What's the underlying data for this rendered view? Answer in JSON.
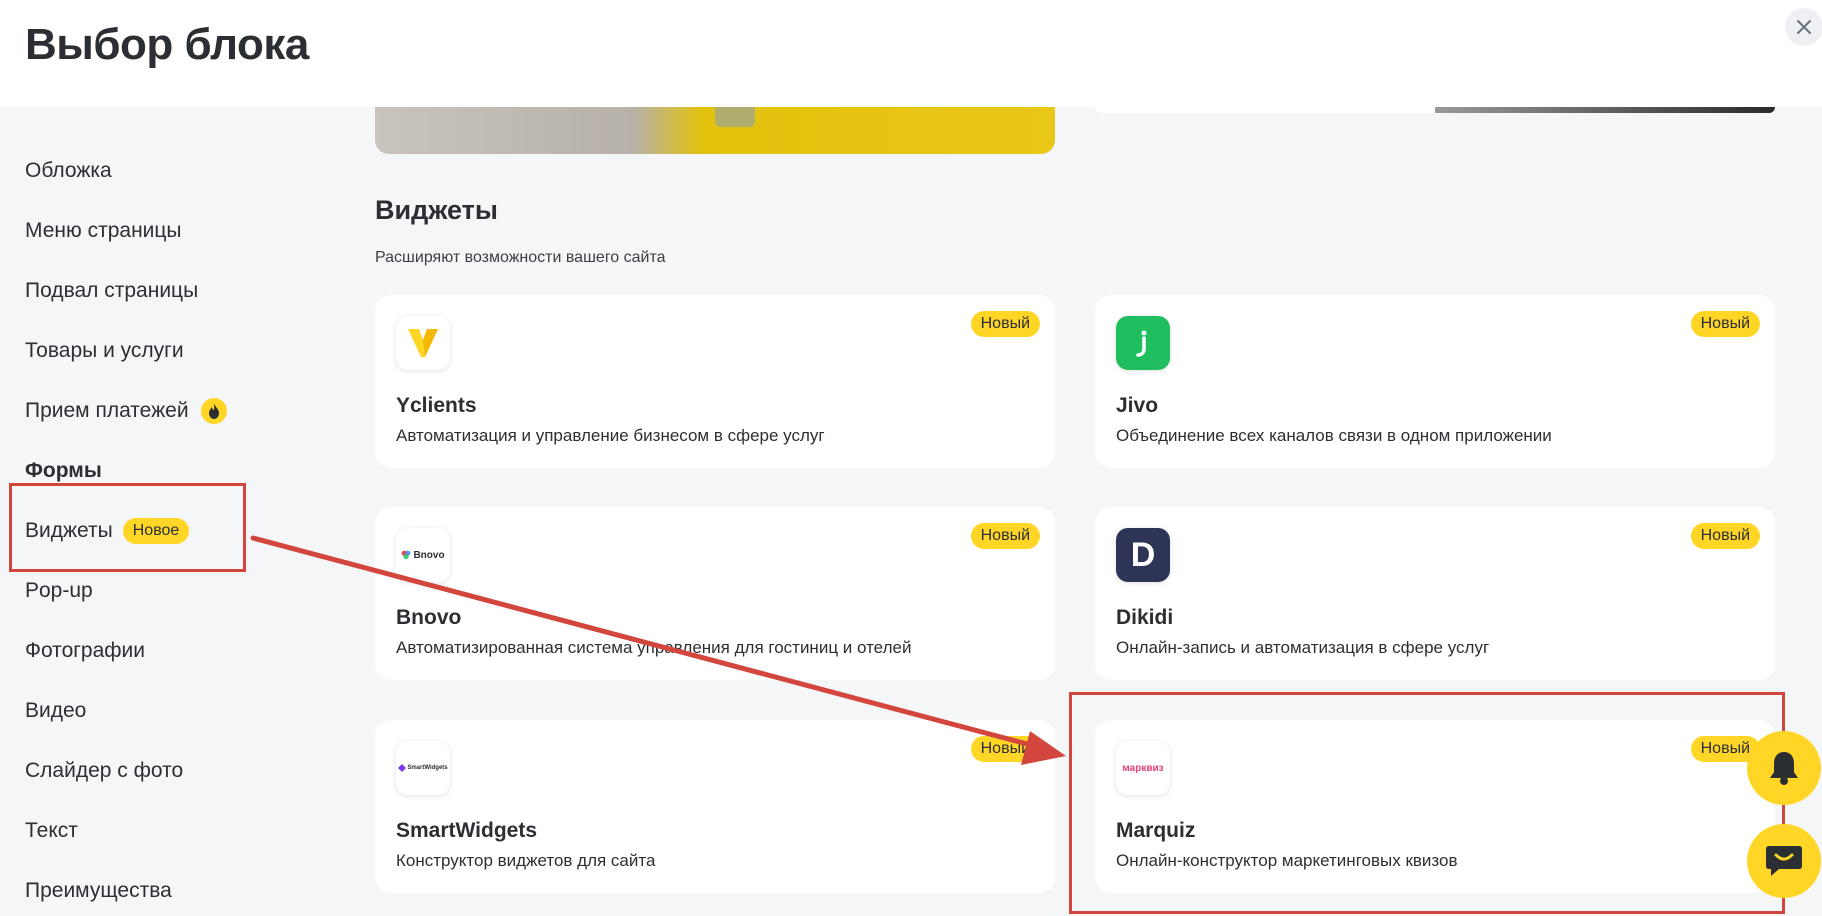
{
  "header": {
    "title": "Выбор блока"
  },
  "sidebar": {
    "items": [
      {
        "label": "Обложка"
      },
      {
        "label": "Меню страницы"
      },
      {
        "label": "Подвал страницы"
      },
      {
        "label": "Товары и услуги"
      },
      {
        "label": "Прием платежей",
        "icon": "fire-icon"
      },
      {
        "label": "Формы"
      },
      {
        "label": "Виджеты",
        "badge": "Новое"
      },
      {
        "label": "Pop-up"
      },
      {
        "label": "Фотографии"
      },
      {
        "label": "Видео"
      },
      {
        "label": "Слайдер с фото"
      },
      {
        "label": "Текст"
      },
      {
        "label": "Преимущества"
      }
    ]
  },
  "main": {
    "section_title": "Виджеты",
    "section_subtitle": "Расширяют возможности вашего сайта",
    "cards": [
      {
        "name": "Yclients",
        "desc": "Автоматизация и управление бизнесом в сфере услуг",
        "badge": "Новый",
        "logo": "yclients-logo"
      },
      {
        "name": "Jivo",
        "desc": "Объединение всех каналов связи в одном приложении",
        "badge": "Новый",
        "logo": "jivo-logo"
      },
      {
        "name": "Bnovo",
        "desc": "Автоматизированная система управления для гостиниц и отелей",
        "badge": "Новый",
        "logo": "bnovo-logo",
        "logo_text": "Bnovo"
      },
      {
        "name": "Dikidi",
        "desc": "Онлайн-запись и автоматизация в сфере услуг",
        "badge": "Новый",
        "logo": "dikidi-logo",
        "logo_text": "D"
      },
      {
        "name": "SmartWidgets",
        "desc": "Конструктор виджетов для сайта",
        "badge": "Новый",
        "logo": "smartwidgets-logo",
        "logo_text": "SmartWidgets"
      },
      {
        "name": "Marquiz",
        "desc": "Онлайн-конструктор маркетинговых квизов",
        "badge": "Новый",
        "logo": "marquiz-logo",
        "logo_text": "марквиз"
      }
    ]
  },
  "colors": {
    "accent": "#ffd626",
    "annotation": "#d2463d",
    "jivo": "#1fbf5f",
    "dikidi": "#2d3455",
    "marquiz": "#e8407a"
  },
  "icons": {
    "close": "close-icon",
    "notifications": "bell-icon",
    "chat": "chat-icon"
  }
}
